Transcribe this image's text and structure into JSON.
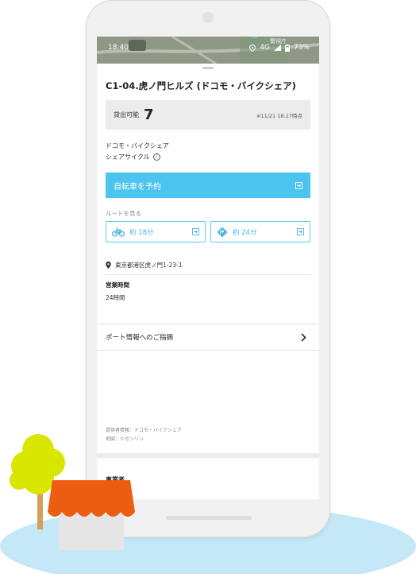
{
  "status_bar": {
    "time": "18:40",
    "network": "4G",
    "battery": "73%"
  },
  "map": {
    "label": "警視庁"
  },
  "station": {
    "title": "C1-04.虎ノ門ヒルズ (ドコモ・バイクシェア)",
    "availability_label": "貸出可能",
    "available_count": "7",
    "updated_at": "※11/21 18:27時点",
    "provider_name": "ドコモ・バイクシェア",
    "service_type": "シェアサイクル",
    "info_icon_glyph": "i"
  },
  "actions": {
    "reserve_label": "自転車を予約"
  },
  "route": {
    "section_label": "ルートを見る",
    "bike_label": "約 18分",
    "car_label": "約 24分"
  },
  "details": {
    "address": "東京都港区虎ノ門1-23-1",
    "hours_label": "営業時間",
    "hours_value": "24時間"
  },
  "report": {
    "label": "ポート情報へのご指摘"
  },
  "credits": {
    "provider": "提供者情報：ドコモ・バイクシェア",
    "map": "地図：©ゼンリン"
  },
  "next_section": {
    "title": "事業者"
  },
  "colors": {
    "accent": "#4cc4f0",
    "route_border": "#5bc6ef",
    "ground": "#c5e8f7",
    "tree_foliage": "#d9e600",
    "tree_trunk": "#d2a05a",
    "roof": "#ec5d12",
    "house_wall": "#e5e5e5"
  },
  "icons": {
    "location": "location-pin-icon",
    "signal": "signal-icon",
    "battery": "battery-icon",
    "bike": "bicycle-icon",
    "car": "car-route-icon",
    "external": "external-link-icon",
    "chevron": "chevron-right-icon",
    "address_pin": "map-pin-icon"
  }
}
